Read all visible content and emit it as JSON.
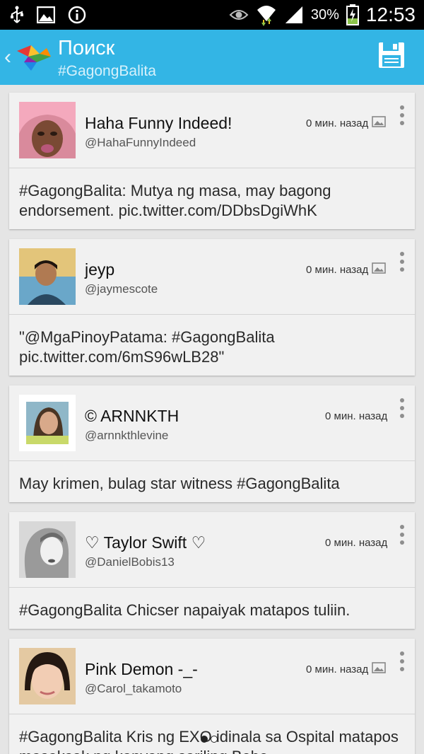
{
  "status_bar": {
    "battery_percent": "30%",
    "time": "12:53",
    "icons": [
      "usb-icon",
      "image-notification-icon",
      "info-icon",
      "eye-icon",
      "wifi-icon",
      "signal-icon",
      "battery-icon"
    ]
  },
  "action_bar": {
    "title": "Поиск",
    "subtitle": "#GagongBalita",
    "accent_color": "#33b5e5"
  },
  "tweets": [
    {
      "name": "Haha Funny Indeed!",
      "handle": "@HahaFunnyIndeed",
      "time": "0 мин. назад",
      "has_image": true,
      "text": "#GagongBalita: Mutya ng masa, may bagong endorsement. pic.twitter.com/DDbsDgiWhK"
    },
    {
      "name": "jeyp",
      "handle": "@jaymescote",
      "time": "0 мин. назад",
      "has_image": true,
      "text": "\"@MgaPinoyPatama: #GagongBalita pic.twitter.com/6mS96wLB28\""
    },
    {
      "name": "© ARNNKTH",
      "handle": "@arnnkthlevine",
      "time": "0 мин. назад",
      "has_image": false,
      "text": "May krimen, bulag star witness #GagongBalita"
    },
    {
      "name": "♡ Taylor Swift ♡",
      "handle": "@DanielBobis13",
      "time": "0 мин. назад",
      "has_image": false,
      "text": "#GagongBalita Chicser napaiyak matapos tuliin."
    },
    {
      "name": "Pink Demon -_-",
      "handle": "@Carol_takamoto",
      "time": "0 мин. назад",
      "has_image": true,
      "text": "#GagongBalita Kris ng EXO idinala sa Ospital matapos masaksak ng kanyang sariling Bebe"
    }
  ],
  "pager": {
    "pages": 2,
    "current": 1
  }
}
